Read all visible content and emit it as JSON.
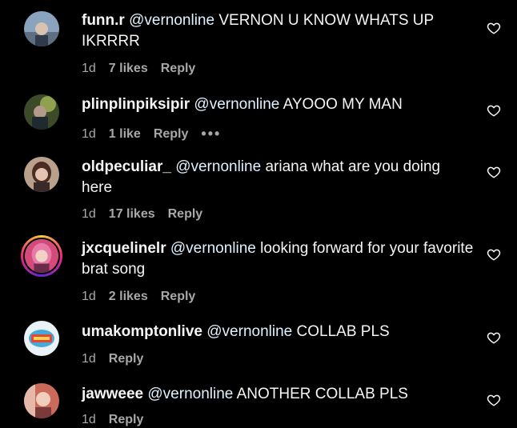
{
  "comments": [
    {
      "username": "funn.r",
      "mention": "@vernonline",
      "text": "VERNON U KNOW WHATS UP IKRRRR",
      "time": "1d",
      "likes": "7 likes",
      "reply": "Reply",
      "avatar_icon": "avatar-photo-icon"
    },
    {
      "username": "plinplinpiksipir",
      "mention": "@vernonline",
      "text": "AYOOO MY MAN",
      "time": "1d",
      "likes": "1 like",
      "reply": "Reply",
      "more": "•••",
      "avatar_icon": "avatar-photo-icon"
    },
    {
      "username": "oldpeculiar_",
      "mention": "@vernonline",
      "text": "ariana what are you doing here",
      "time": "1d",
      "likes": "17 likes",
      "reply": "Reply",
      "avatar_icon": "avatar-photo-icon"
    },
    {
      "username": "jxcquelinelr",
      "mention": "@vernonline",
      "text": "looking forward for your favorite brat song",
      "time": "1d",
      "likes": "2 likes",
      "reply": "Reply",
      "avatar_icon": "avatar-story-ring-icon"
    },
    {
      "username": "umakomptonlive",
      "mention": "@vernonline",
      "text": "COLLAB PLS",
      "time": "1d",
      "reply": "Reply",
      "avatar_icon": "avatar-logo-icon"
    },
    {
      "username": "jawweee",
      "mention": "@vernonline",
      "text": "ANOTHER COLLAB PLS",
      "time": "1d",
      "reply": "Reply",
      "avatar_icon": "avatar-photo-icon"
    }
  ],
  "icons": {
    "like": "heart-outline-icon"
  },
  "colors": {
    "background": "#000000",
    "text": "#f5f5f5",
    "secondary": "#a8a8a8"
  }
}
